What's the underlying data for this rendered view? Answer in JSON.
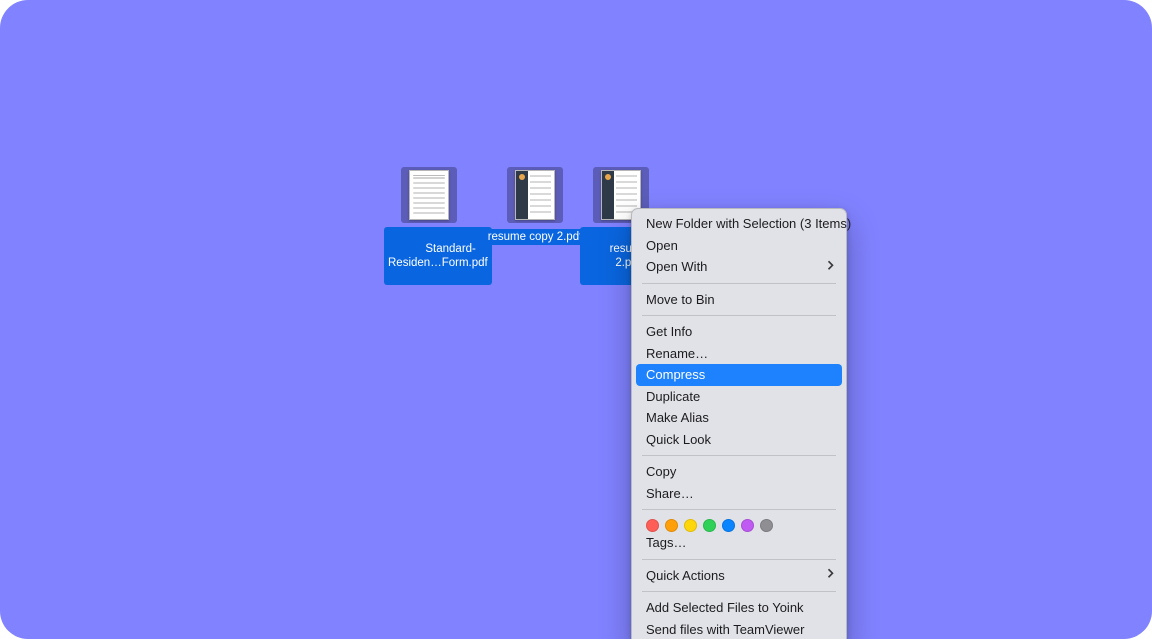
{
  "desktop": {
    "files": [
      {
        "label_line1": "Standard-",
        "label_line2": "Residen…Form.pdf"
      },
      {
        "label_line1": "resume copy 2.pdf",
        "label_line2": ""
      },
      {
        "label_line1": "resume copy",
        "label_line2": "2.png"
      }
    ]
  },
  "context_menu": {
    "new_folder_with_selection": "New Folder with Selection (3 Items)",
    "open": "Open",
    "open_with": "Open With",
    "move_to_bin": "Move to Bin",
    "get_info": "Get Info",
    "rename": "Rename…",
    "compress": "Compress",
    "duplicate": "Duplicate",
    "make_alias": "Make Alias",
    "quick_look": "Quick Look",
    "copy": "Copy",
    "share": "Share…",
    "tags": "Tags…",
    "quick_actions": "Quick Actions",
    "add_to_yoink": "Add Selected Files to Yoink",
    "send_teamviewer": "Send files with TeamViewer",
    "tag_colors": [
      "#ff5e57",
      "#ff9f0a",
      "#ffd60a",
      "#30d158",
      "#0a84ff",
      "#bf5af2",
      "#8e8e93"
    ]
  }
}
